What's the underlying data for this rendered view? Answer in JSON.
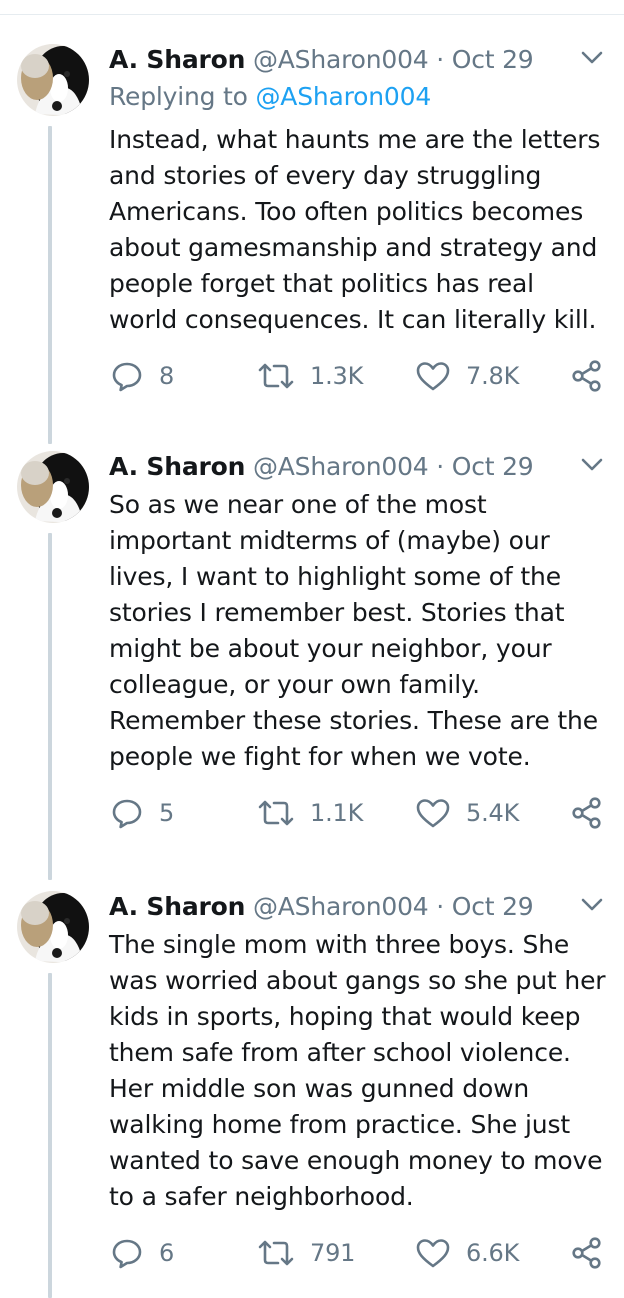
{
  "tweets": [
    {
      "author_name": "A. Sharon",
      "handle": "@ASharon004",
      "separator": "·",
      "date": "Oct 29",
      "replying_label": "Replying to",
      "replying_handle": "@ASharon004",
      "text_lines": [
        "Instead, what haunts me are the letters",
        "and stories of every day struggling",
        "Americans. Too often politics becomes",
        "about gamesmanship and strategy and",
        "people forget that politics has real",
        "world consequences. It can literally kill."
      ],
      "replies": "8",
      "retweets": "1.3K",
      "likes": "7.8K"
    },
    {
      "author_name": "A. Sharon",
      "handle": "@ASharon004",
      "separator": "·",
      "date": "Oct 29",
      "text_lines": [
        "So as we near one of the most",
        "important midterms of (maybe) our",
        "lives, I want to highlight some of the",
        "stories I remember best. Stories that",
        "might be about your neighbor, your",
        "colleague, or your own family.",
        "Remember these stories. These are the",
        "people we fight for when we vote."
      ],
      "replies": "5",
      "retweets": "1.1K",
      "likes": "5.4K"
    },
    {
      "author_name": "A. Sharon",
      "handle": "@ASharon004",
      "separator": "·",
      "date": "Oct 29",
      "text_lines": [
        "The single mom with three boys. She",
        "was worried about gangs so she put her",
        "kids in sports, hoping that would keep",
        "them safe from after school violence.",
        "Her middle son was gunned down",
        "walking home from practice. She just",
        "wanted to save enough money to move",
        "to a safer neighborhood."
      ],
      "replies": "6",
      "retweets": "791",
      "likes": "6.6K"
    }
  ],
  "icons": {
    "reply": "reply-icon",
    "retweet": "retweet-icon",
    "like": "heart-icon",
    "share": "share-icon",
    "menu": "chevron-down-icon"
  },
  "colors": {
    "text": "#14171a",
    "secondary": "#657786",
    "link": "#1da1f2",
    "thread_line": "#ccd6dd"
  }
}
